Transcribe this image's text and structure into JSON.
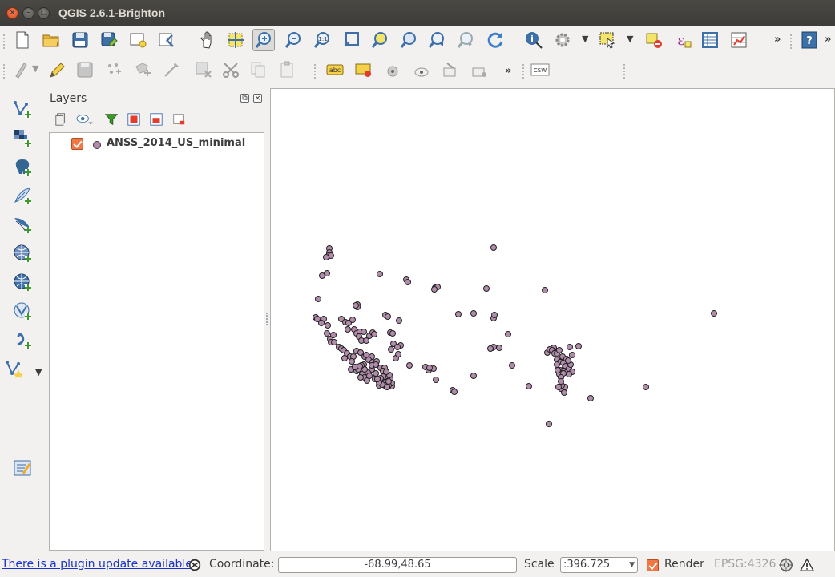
{
  "window": {
    "title": "QGIS 2.6.1-Brighton"
  },
  "toolbar_main": {
    "overflow_label": "»",
    "items": [
      "new-project",
      "open-project",
      "save-project",
      "save-project-as",
      "new-print-composer",
      "composer-manager",
      "pan-map",
      "pan-to-selection",
      "zoom-in",
      "zoom-out",
      "zoom-actual-size",
      "zoom-full",
      "zoom-to-selection",
      "zoom-to-layer",
      "zoom-last",
      "zoom-next",
      "refresh",
      "identify-features",
      "run-feature-action",
      "select-features",
      "deselect-all",
      "field-calculator",
      "attribute-table",
      "statistics"
    ]
  },
  "toolbar_edit": {
    "overflow_label": "»",
    "csw_label": "CSW",
    "label_tool_text": "abc"
  },
  "layers_panel": {
    "title": "Layers",
    "layers": [
      {
        "name": "ANSS_2014_US_minimal",
        "checked": true,
        "symbol_color": "#b28cab"
      }
    ]
  },
  "map": {
    "background": "#ffffff",
    "point_fill": "#b28cab",
    "point_stroke": "#222222"
  },
  "statusbar": {
    "plugin_message": "There is a plugin update available",
    "coordinate_label": "Coordinate:",
    "coordinate_value": "-68.99,48.65",
    "scale_label": "Scale",
    "scale_value": ":396.725",
    "render_label": "Render",
    "render_checked": true,
    "crs": "EPSG:4326"
  }
}
